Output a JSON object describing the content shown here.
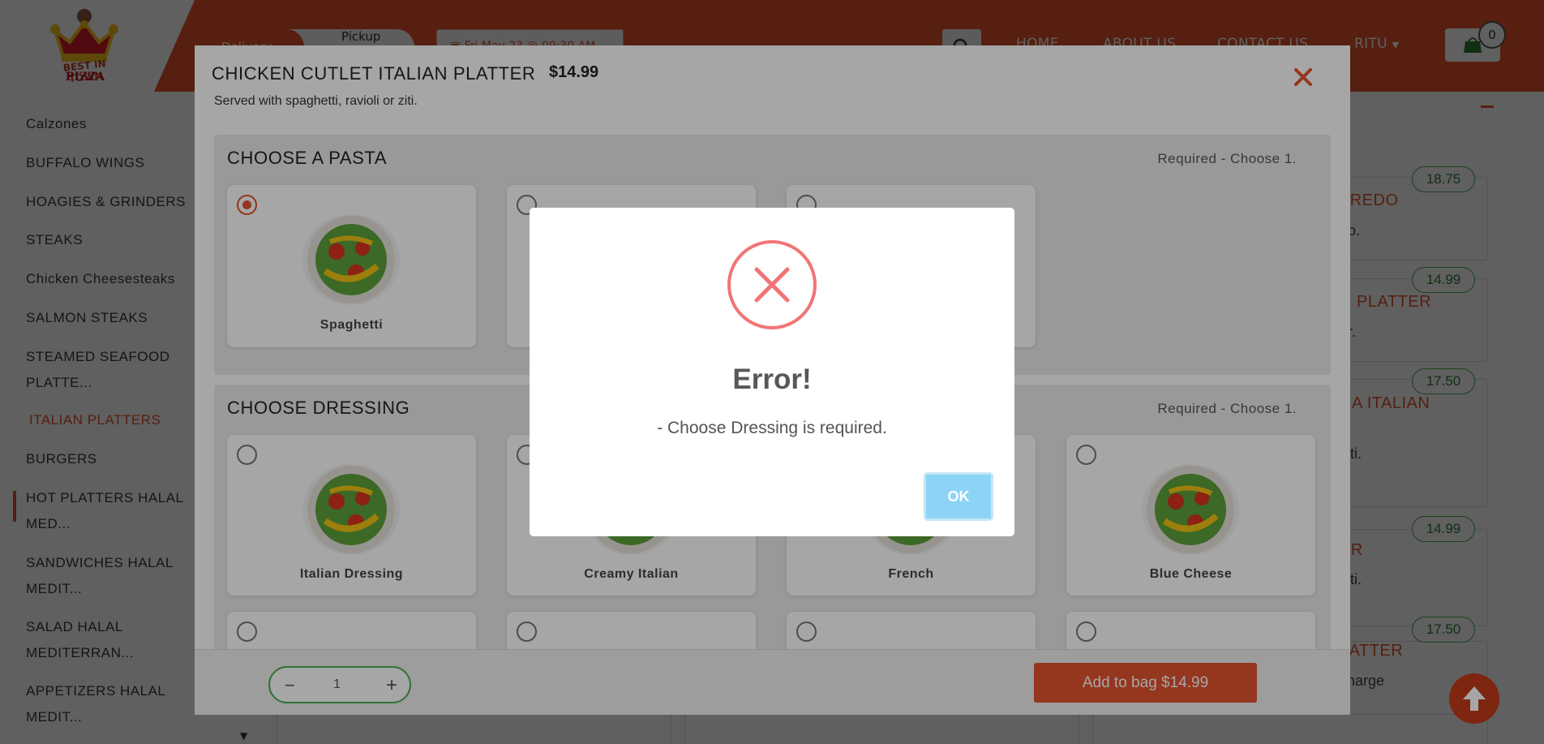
{
  "header": {
    "logo_text_top": "BEST IN TOWN",
    "logo_text_bottom": "PIZZA",
    "toggle_active": "Delivery",
    "toggle_inactive": "Pickup",
    "datetime": "Fri May 23 @ 09:30 AM",
    "nav": [
      "HOME",
      "ABOUT US",
      "CONTACT US",
      "RITU"
    ],
    "cart_count": "0"
  },
  "sidebar": {
    "items": [
      {
        "label": "Calzones"
      },
      {
        "label": "BUFFALO WINGS"
      },
      {
        "label": "HOAGIES & GRINDERS"
      },
      {
        "label": "STEAKS"
      },
      {
        "label": "Chicken Cheesesteaks"
      },
      {
        "label": "SALMON STEAKS"
      },
      {
        "label": "STEAMED SEAFOOD",
        "label2": "PLATTE..."
      },
      {
        "label": "ITALIAN PLATTERS"
      },
      {
        "label": "BURGERS"
      },
      {
        "label": "HOT PLATTERS HALAL",
        "label2": "MED..."
      },
      {
        "label": "SANDWICHES HALAL",
        "label2": "MEDIT..."
      },
      {
        "label": "SALAD HALAL",
        "label2": "MEDITERRAN..."
      },
      {
        "label": "APPETIZERS HALAL",
        "label2": "MEDIT..."
      }
    ]
  },
  "background_items": [
    {
      "price": "18.75",
      "title": "FREDO",
      "desc": "do."
    },
    {
      "price": "14.99",
      "title": "N PLATTER",
      "desc": "er."
    },
    {
      "price": "17.50",
      "title": "NA ITALIAN",
      "desc": "ziti."
    },
    {
      "price": "14.99",
      "title": "ER",
      "desc": "ziti."
    },
    {
      "price": "17.50",
      "title": "LATTER",
      "desc": "charge"
    }
  ],
  "modal": {
    "title": "CHICKEN CUTLET ITALIAN PLATTER",
    "price": "$14.99",
    "description": "Served with spaghetti, ravioli or ziti.",
    "sections": [
      {
        "title": "CHOOSE A PASTA",
        "requirement": "Required - Choose 1.",
        "options": [
          "Spaghetti",
          "",
          ""
        ]
      },
      {
        "title": "CHOOSE DRESSING",
        "requirement": "Required - Choose 1.",
        "options": [
          "Italian Dressing",
          "Creamy Italian",
          "French",
          "Blue Cheese"
        ]
      }
    ],
    "quantity": "1",
    "add_to_bag": "Add to bag $14.99"
  },
  "dialog": {
    "title": "Error!",
    "message": "- Choose Dressing is required.",
    "ok_label": "OK"
  },
  "colors": {
    "brand": "#e5532e",
    "error": "#f27474",
    "ok_button": "#8cd4f5",
    "price_green": "#2e7d32"
  },
  "icons": {
    "search": "search-icon",
    "cart": "shopping-bag-icon",
    "close": "close-icon",
    "error": "error-x-icon",
    "scroll_top": "arrow-up-icon"
  }
}
